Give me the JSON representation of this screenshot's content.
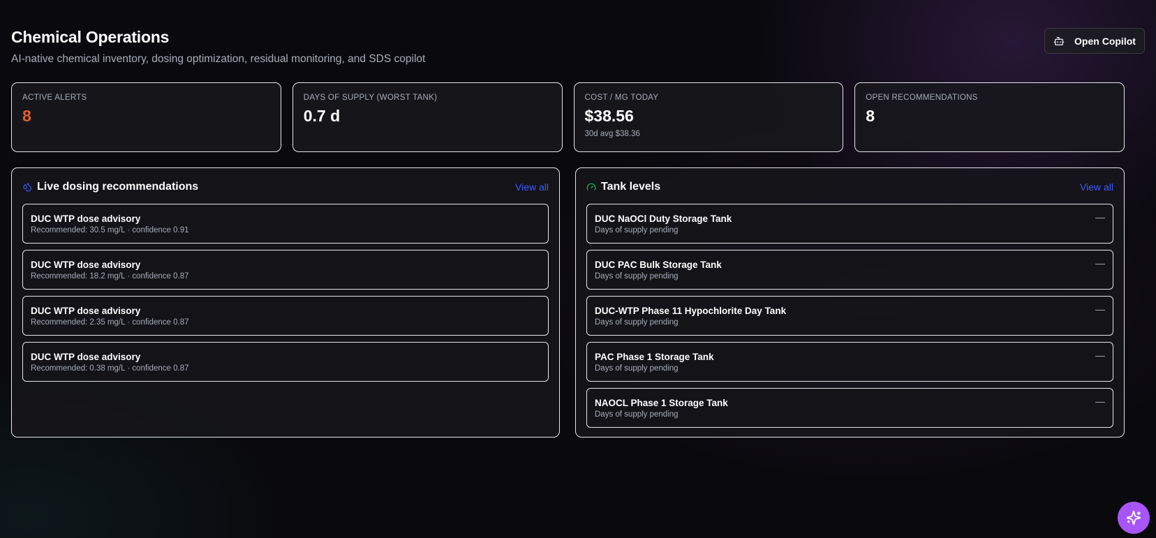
{
  "header": {
    "title": "Chemical Operations",
    "subtitle": "AI-native chemical inventory, dosing optimization, residual monitoring, and SDS copilot",
    "copilot_button": "Open Copilot"
  },
  "stats": [
    {
      "label": "ACTIVE ALERTS",
      "value": "8",
      "sub": ""
    },
    {
      "label": "DAYS OF SUPPLY (WORST TANK)",
      "value": "0.7 d",
      "sub": ""
    },
    {
      "label": "COST / MG TODAY",
      "value": "$38.56",
      "sub": "30d avg $38.36"
    },
    {
      "label": "OPEN RECOMMENDATIONS",
      "value": "8",
      "sub": ""
    }
  ],
  "dosing": {
    "title": "Live dosing recommendations",
    "view_all": "View all",
    "items": [
      {
        "title": "DUC WTP dose advisory",
        "sub": "Recommended: 30.5 mg/L · confidence 0.91"
      },
      {
        "title": "DUC WTP dose advisory",
        "sub": "Recommended: 18.2 mg/L · confidence 0.87"
      },
      {
        "title": "DUC WTP dose advisory",
        "sub": "Recommended: 2.35 mg/L · confidence 0.87"
      },
      {
        "title": "DUC WTP dose advisory",
        "sub": "Recommended: 0.38 mg/L · confidence 0.87"
      }
    ]
  },
  "tanks": {
    "title": "Tank levels",
    "view_all": "View all",
    "items": [
      {
        "title": "DUC NaOCl Duty Storage Tank",
        "sub": "Days of supply pending",
        "level": "—"
      },
      {
        "title": "DUC PAC Bulk Storage Tank",
        "sub": "Days of supply pending",
        "level": "—"
      },
      {
        "title": "DUC-WTP Phase 11 Hypochlorite Day Tank",
        "sub": "Days of supply pending",
        "level": "—"
      },
      {
        "title": "PAC Phase 1 Storage Tank",
        "sub": "Days of supply pending",
        "level": "—"
      },
      {
        "title": "NAOCL Phase 1 Storage Tank",
        "sub": "Days of supply pending",
        "level": "—"
      }
    ]
  },
  "colors": {
    "alert": "#e0602a",
    "link": "#3b5bff",
    "fab": "#a855f7",
    "dosing_icon": "#3b5bff",
    "tank_icon": "#22c55e"
  },
  "icons": {
    "copilot": "bot-icon",
    "dosing": "droplets-icon",
    "tanks": "gauge-icon",
    "fab": "sparkles-icon"
  }
}
